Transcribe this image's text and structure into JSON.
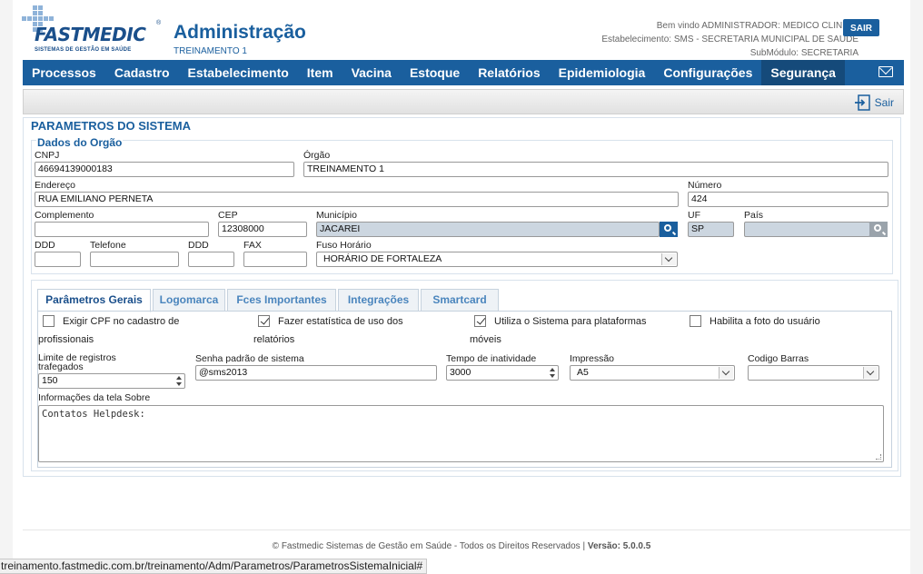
{
  "brand": {
    "logo_word": "FASTMEDIC",
    "logo_sub": "SISTEMAS DE GESTÃO EM SAÚDE",
    "reg": "®"
  },
  "header": {
    "title": "Administração",
    "subtitle": "TREINAMENTO 1",
    "welcome": "Bem vindo ADMINISTRADOR: MEDICO CLINICO",
    "establishment": "Estabelecimento: SMS - SECRETARIA MUNICIPAL DE SAUDE",
    "submodule": "SubMódulo: SECRETARIA",
    "logout_label": "SAIR"
  },
  "nav": {
    "items": [
      "Processos",
      "Cadastro",
      "Estabelecimento",
      "Item",
      "Vacina",
      "Estoque",
      "Relatórios",
      "Epidemiologia",
      "Configurações",
      "Segurança"
    ],
    "active": "Segurança",
    "mail_icon": "mail-icon"
  },
  "toolbar": {
    "exit_label": "Sair"
  },
  "page": {
    "title": "PARAMETROS DO SISTEMA"
  },
  "org": {
    "legend": "Dados do Orgão",
    "cnpj_label": "CNPJ",
    "cnpj": "46694139000183",
    "orgao_label": "Órgão",
    "orgao": "TREINAMENTO 1",
    "endereco_label": "Endereço",
    "endereco": "RUA EMILIANO PERNETA",
    "numero_label": "Número",
    "numero": "424",
    "complemento_label": "Complemento",
    "complemento": "",
    "cep_label": "CEP",
    "cep": "12308000",
    "municipio_label": "Município",
    "municipio": "JACAREI",
    "uf_label": "UF",
    "uf": "SP",
    "pais_label": "País",
    "pais": "",
    "ddd_label": "DDD",
    "ddd": "",
    "telefone_label": "Telefone",
    "telefone": "",
    "ddd2_label": "DDD",
    "ddd2": "",
    "fax_label": "FAX",
    "fax": "",
    "fuso_label": "Fuso Horário",
    "fuso": "HORÁRIO DE FORTALEZA"
  },
  "tabs": [
    "Parâmetros Gerais",
    "Logomarca",
    "Fces Importantes",
    "Integrações",
    "Smartcard"
  ],
  "params": {
    "cpf_line1": "Exigir CPF no cadastro de",
    "cpf_line2": "profissionais",
    "cpf_checked": false,
    "stats_line1": "Fazer estatística de uso dos",
    "stats_line2": "relatórios",
    "stats_checked": true,
    "mobile_line1": "Utiliza o Sistema para plataformas",
    "mobile_line2": "móveis",
    "mobile_checked": true,
    "photo_label": "Habilita a foto do usuário",
    "photo_checked": false,
    "limit_label": "Limite de registros trafegados",
    "limit": "150",
    "password_label": "Senha padrão de sistema",
    "password": "@sms2013",
    "idle_label": "Tempo de inatividade",
    "idle": "3000",
    "print_label": "Impressão",
    "print": "A5",
    "barcode_label": "Codigo Barras",
    "barcode": "",
    "about_label": "Informações da tela Sobre",
    "about": "Contatos Helpdesk:"
  },
  "footer": {
    "text": "© Fastmedic Sistemas de Gestão em Saúde - Todos os Direitos Reservados | ",
    "version_label": "Versão: 5.0.0.5"
  },
  "status_url": "treinamento.fastmedic.com.br/treinamento/Adm/Parametros/ParametrosSistemaInicial#"
}
